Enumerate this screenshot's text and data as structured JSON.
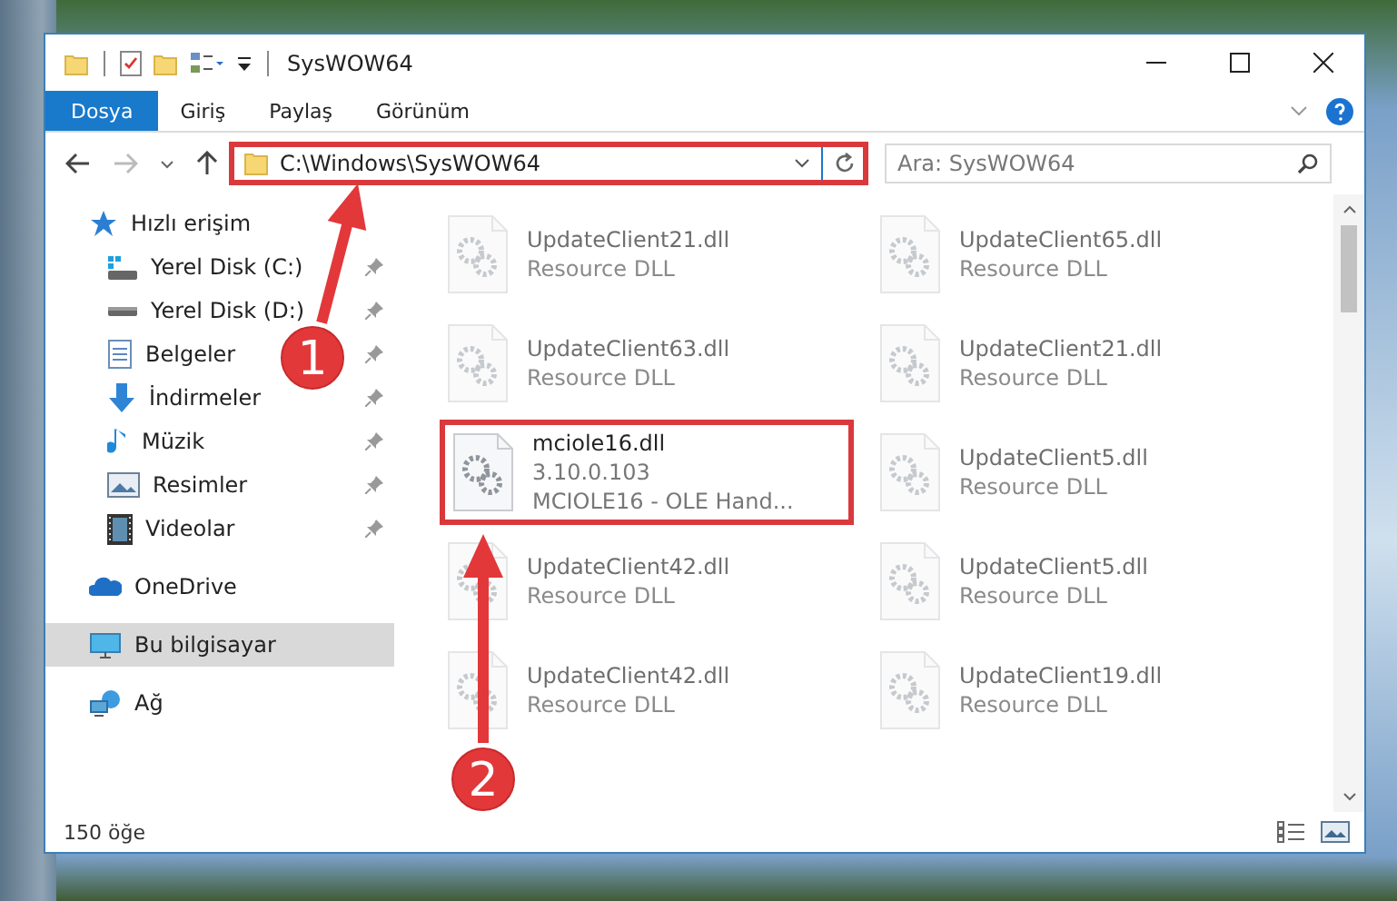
{
  "window": {
    "title": "SysWOW64"
  },
  "ribbon_tabs": [
    {
      "label": "Dosya",
      "selected": true
    },
    {
      "label": "Giriş",
      "selected": false
    },
    {
      "label": "Paylaş",
      "selected": false
    },
    {
      "label": "Görünüm",
      "selected": false
    }
  ],
  "address": {
    "path": "C:\\Windows\\SysWOW64",
    "highlighted": true
  },
  "search": {
    "placeholder": "Ara: SysWOW64"
  },
  "nav": [
    {
      "label": "Hızlı erişim",
      "kind": "star",
      "selected": false,
      "children": [
        {
          "label": "Yerel Disk (C:)",
          "kind": "systemdrive",
          "pinned": true,
          "selected": false
        },
        {
          "label": "Yerel Disk (D:)",
          "kind": "drive",
          "pinned": true,
          "selected": false
        },
        {
          "label": "Belgeler",
          "kind": "documents",
          "pinned": true,
          "selected": false
        },
        {
          "label": "İndirmeler",
          "kind": "downloads",
          "pinned": true,
          "selected": false
        },
        {
          "label": "Müzik",
          "kind": "music",
          "pinned": true,
          "selected": false
        },
        {
          "label": "Resimler",
          "kind": "pictures",
          "pinned": true,
          "selected": false
        },
        {
          "label": "Videolar",
          "kind": "videos",
          "pinned": true,
          "selected": false
        }
      ]
    },
    {
      "label": "OneDrive",
      "kind": "cloud",
      "selected": false
    },
    {
      "label": "Bu bilgisayar",
      "kind": "computer",
      "selected": true
    },
    {
      "label": "Ağ",
      "kind": "network",
      "selected": false
    }
  ],
  "files": [
    {
      "name": "UpdateClient21.dll",
      "details": [
        "Resource DLL"
      ],
      "faded": true,
      "highlighted": false
    },
    {
      "name": "UpdateClient65.dll",
      "details": [
        "Resource DLL"
      ],
      "faded": true,
      "highlighted": false
    },
    {
      "name": "UpdateClient63.dll",
      "details": [
        "Resource DLL"
      ],
      "faded": true,
      "highlighted": false
    },
    {
      "name": "UpdateClient21.dll",
      "details": [
        "Resource DLL"
      ],
      "faded": true,
      "highlighted": false
    },
    {
      "name": "mciole16.dll",
      "details": [
        "3.10.0.103",
        "MCIOLE16 - OLE Hand..."
      ],
      "faded": false,
      "highlighted": true
    },
    {
      "name": "UpdateClient5.dll",
      "details": [
        "Resource DLL"
      ],
      "faded": true,
      "highlighted": false
    },
    {
      "name": "UpdateClient42.dll",
      "details": [
        "Resource DLL"
      ],
      "faded": true,
      "highlighted": false
    },
    {
      "name": "UpdateClient5.dll",
      "details": [
        "Resource DLL"
      ],
      "faded": true,
      "highlighted": false
    },
    {
      "name": "UpdateClient42.dll",
      "details": [
        "Resource DLL"
      ],
      "faded": true,
      "highlighted": false
    },
    {
      "name": "UpdateClient19.dll",
      "details": [
        "Resource DLL"
      ],
      "faded": true,
      "highlighted": false
    }
  ],
  "status_bar": {
    "count": "150 öğe"
  },
  "steps": [
    {
      "number": "1"
    },
    {
      "number": "2"
    }
  ]
}
